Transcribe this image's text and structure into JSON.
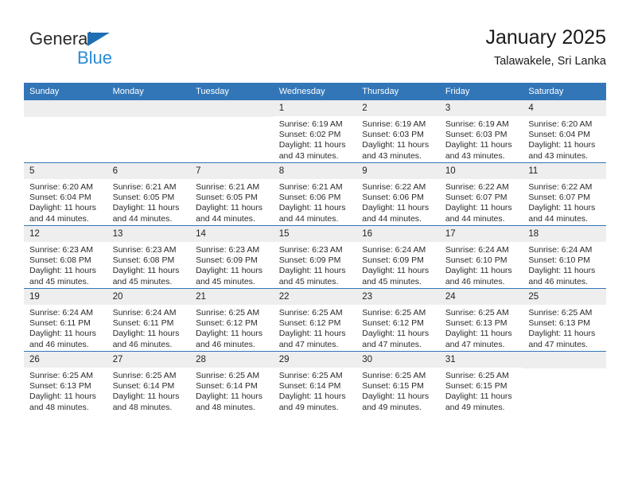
{
  "brand": {
    "name_top": "General",
    "name_bottom": "Blue",
    "accent_color": "#2a8bd5",
    "triangle_color": "#1f6fb2"
  },
  "header": {
    "title": "January 2025",
    "subtitle": "Talawakele, Sri Lanka",
    "header_bg": "#3276b8",
    "daynum_bg": "#eeeeee"
  },
  "weekdays": [
    "Sunday",
    "Monday",
    "Tuesday",
    "Wednesday",
    "Thursday",
    "Friday",
    "Saturday"
  ],
  "labels": {
    "sunrise": "Sunrise:",
    "sunset": "Sunset:",
    "daylight": "Daylight:"
  },
  "weeks": [
    [
      {
        "empty": true
      },
      {
        "empty": true
      },
      {
        "empty": true
      },
      {
        "day": "1",
        "sunrise": "Sunrise: 6:19 AM",
        "sunset": "Sunset: 6:02 PM",
        "daylight1": "Daylight: 11 hours",
        "daylight2": "and 43 minutes."
      },
      {
        "day": "2",
        "sunrise": "Sunrise: 6:19 AM",
        "sunset": "Sunset: 6:03 PM",
        "daylight1": "Daylight: 11 hours",
        "daylight2": "and 43 minutes."
      },
      {
        "day": "3",
        "sunrise": "Sunrise: 6:19 AM",
        "sunset": "Sunset: 6:03 PM",
        "daylight1": "Daylight: 11 hours",
        "daylight2": "and 43 minutes."
      },
      {
        "day": "4",
        "sunrise": "Sunrise: 6:20 AM",
        "sunset": "Sunset: 6:04 PM",
        "daylight1": "Daylight: 11 hours",
        "daylight2": "and 43 minutes."
      }
    ],
    [
      {
        "day": "5",
        "sunrise": "Sunrise: 6:20 AM",
        "sunset": "Sunset: 6:04 PM",
        "daylight1": "Daylight: 11 hours",
        "daylight2": "and 44 minutes."
      },
      {
        "day": "6",
        "sunrise": "Sunrise: 6:21 AM",
        "sunset": "Sunset: 6:05 PM",
        "daylight1": "Daylight: 11 hours",
        "daylight2": "and 44 minutes."
      },
      {
        "day": "7",
        "sunrise": "Sunrise: 6:21 AM",
        "sunset": "Sunset: 6:05 PM",
        "daylight1": "Daylight: 11 hours",
        "daylight2": "and 44 minutes."
      },
      {
        "day": "8",
        "sunrise": "Sunrise: 6:21 AM",
        "sunset": "Sunset: 6:06 PM",
        "daylight1": "Daylight: 11 hours",
        "daylight2": "and 44 minutes."
      },
      {
        "day": "9",
        "sunrise": "Sunrise: 6:22 AM",
        "sunset": "Sunset: 6:06 PM",
        "daylight1": "Daylight: 11 hours",
        "daylight2": "and 44 minutes."
      },
      {
        "day": "10",
        "sunrise": "Sunrise: 6:22 AM",
        "sunset": "Sunset: 6:07 PM",
        "daylight1": "Daylight: 11 hours",
        "daylight2": "and 44 minutes."
      },
      {
        "day": "11",
        "sunrise": "Sunrise: 6:22 AM",
        "sunset": "Sunset: 6:07 PM",
        "daylight1": "Daylight: 11 hours",
        "daylight2": "and 44 minutes."
      }
    ],
    [
      {
        "day": "12",
        "sunrise": "Sunrise: 6:23 AM",
        "sunset": "Sunset: 6:08 PM",
        "daylight1": "Daylight: 11 hours",
        "daylight2": "and 45 minutes."
      },
      {
        "day": "13",
        "sunrise": "Sunrise: 6:23 AM",
        "sunset": "Sunset: 6:08 PM",
        "daylight1": "Daylight: 11 hours",
        "daylight2": "and 45 minutes."
      },
      {
        "day": "14",
        "sunrise": "Sunrise: 6:23 AM",
        "sunset": "Sunset: 6:09 PM",
        "daylight1": "Daylight: 11 hours",
        "daylight2": "and 45 minutes."
      },
      {
        "day": "15",
        "sunrise": "Sunrise: 6:23 AM",
        "sunset": "Sunset: 6:09 PM",
        "daylight1": "Daylight: 11 hours",
        "daylight2": "and 45 minutes."
      },
      {
        "day": "16",
        "sunrise": "Sunrise: 6:24 AM",
        "sunset": "Sunset: 6:09 PM",
        "daylight1": "Daylight: 11 hours",
        "daylight2": "and 45 minutes."
      },
      {
        "day": "17",
        "sunrise": "Sunrise: 6:24 AM",
        "sunset": "Sunset: 6:10 PM",
        "daylight1": "Daylight: 11 hours",
        "daylight2": "and 46 minutes."
      },
      {
        "day": "18",
        "sunrise": "Sunrise: 6:24 AM",
        "sunset": "Sunset: 6:10 PM",
        "daylight1": "Daylight: 11 hours",
        "daylight2": "and 46 minutes."
      }
    ],
    [
      {
        "day": "19",
        "sunrise": "Sunrise: 6:24 AM",
        "sunset": "Sunset: 6:11 PM",
        "daylight1": "Daylight: 11 hours",
        "daylight2": "and 46 minutes."
      },
      {
        "day": "20",
        "sunrise": "Sunrise: 6:24 AM",
        "sunset": "Sunset: 6:11 PM",
        "daylight1": "Daylight: 11 hours",
        "daylight2": "and 46 minutes."
      },
      {
        "day": "21",
        "sunrise": "Sunrise: 6:25 AM",
        "sunset": "Sunset: 6:12 PM",
        "daylight1": "Daylight: 11 hours",
        "daylight2": "and 46 minutes."
      },
      {
        "day": "22",
        "sunrise": "Sunrise: 6:25 AM",
        "sunset": "Sunset: 6:12 PM",
        "daylight1": "Daylight: 11 hours",
        "daylight2": "and 47 minutes."
      },
      {
        "day": "23",
        "sunrise": "Sunrise: 6:25 AM",
        "sunset": "Sunset: 6:12 PM",
        "daylight1": "Daylight: 11 hours",
        "daylight2": "and 47 minutes."
      },
      {
        "day": "24",
        "sunrise": "Sunrise: 6:25 AM",
        "sunset": "Sunset: 6:13 PM",
        "daylight1": "Daylight: 11 hours",
        "daylight2": "and 47 minutes."
      },
      {
        "day": "25",
        "sunrise": "Sunrise: 6:25 AM",
        "sunset": "Sunset: 6:13 PM",
        "daylight1": "Daylight: 11 hours",
        "daylight2": "and 47 minutes."
      }
    ],
    [
      {
        "day": "26",
        "sunrise": "Sunrise: 6:25 AM",
        "sunset": "Sunset: 6:13 PM",
        "daylight1": "Daylight: 11 hours",
        "daylight2": "and 48 minutes."
      },
      {
        "day": "27",
        "sunrise": "Sunrise: 6:25 AM",
        "sunset": "Sunset: 6:14 PM",
        "daylight1": "Daylight: 11 hours",
        "daylight2": "and 48 minutes."
      },
      {
        "day": "28",
        "sunrise": "Sunrise: 6:25 AM",
        "sunset": "Sunset: 6:14 PM",
        "daylight1": "Daylight: 11 hours",
        "daylight2": "and 48 minutes."
      },
      {
        "day": "29",
        "sunrise": "Sunrise: 6:25 AM",
        "sunset": "Sunset: 6:14 PM",
        "daylight1": "Daylight: 11 hours",
        "daylight2": "and 49 minutes."
      },
      {
        "day": "30",
        "sunrise": "Sunrise: 6:25 AM",
        "sunset": "Sunset: 6:15 PM",
        "daylight1": "Daylight: 11 hours",
        "daylight2": "and 49 minutes."
      },
      {
        "day": "31",
        "sunrise": "Sunrise: 6:25 AM",
        "sunset": "Sunset: 6:15 PM",
        "daylight1": "Daylight: 11 hours",
        "daylight2": "and 49 minutes."
      },
      {
        "empty": true
      }
    ]
  ]
}
